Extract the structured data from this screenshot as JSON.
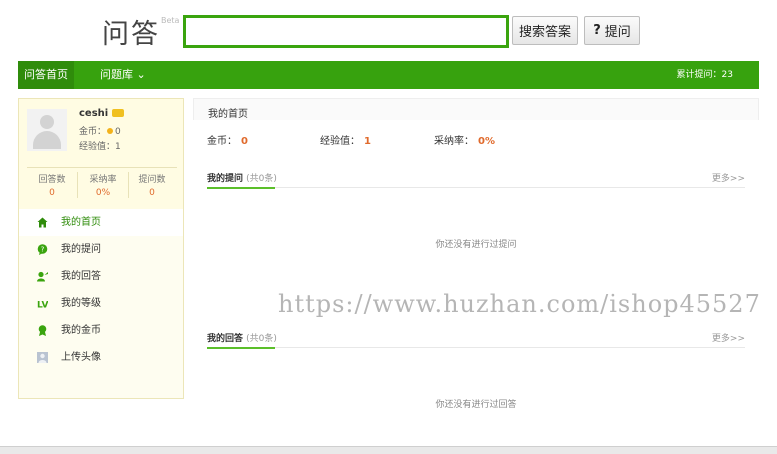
{
  "header": {
    "logo": "问答",
    "beta": "Beta",
    "search_value": "",
    "search_button": "搜索答案",
    "ask_icon": "?",
    "ask_button": "提问"
  },
  "nav": {
    "home": "问答首页",
    "library": "问题库 ⌄",
    "total": "累计提问：23"
  },
  "profile": {
    "username": "ceshi",
    "coin_label": "金币：",
    "coin_value": "0",
    "exp_label": "经验值：",
    "exp_value": "1",
    "stats": [
      {
        "label": "回答数",
        "value": "0"
      },
      {
        "label": "采纳率",
        "value": "0%"
      },
      {
        "label": "提问数",
        "value": "0"
      }
    ]
  },
  "menu": [
    {
      "label": "我的首页",
      "icon": "home-icon",
      "color": "#2f8c0b"
    },
    {
      "label": "我的提问",
      "icon": "question-bubble-icon",
      "color": "#3aa40e"
    },
    {
      "label": "我的回答",
      "icon": "user-answer-icon",
      "color": "#3aa40e"
    },
    {
      "label": "我的等级",
      "icon": "level-icon",
      "color": "#3aa40e"
    },
    {
      "label": "我的金币",
      "icon": "medal-icon",
      "color": "#3aa40e"
    },
    {
      "label": "上传头像",
      "icon": "avatar-upload-icon",
      "color": "#9aa6b8"
    }
  ],
  "main": {
    "title": "我的首页",
    "metrics": [
      {
        "label": "金币：",
        "value": "0"
      },
      {
        "label": "经验值：",
        "value": "1"
      },
      {
        "label": "采纳率：",
        "value": "0%"
      }
    ],
    "questions": {
      "title": "我的提问",
      "count": "(共0条)",
      "more": "更多>>",
      "empty": "你还没有进行过提问"
    },
    "answers": {
      "title": "我的回答",
      "count": "(共0条)",
      "more": "更多>>",
      "empty": "你还没有进行过回答"
    }
  },
  "watermark": "https://www.huzhan.com/ishop45527"
}
